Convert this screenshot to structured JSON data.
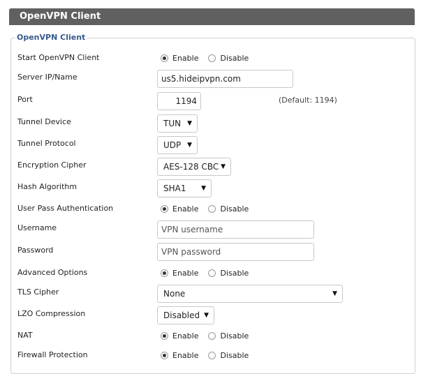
{
  "header": {
    "title": "OpenVPN Client"
  },
  "section": {
    "legend": "OpenVPN Client"
  },
  "labels": {
    "start": "Start OpenVPN Client",
    "server": "Server IP/Name",
    "port": "Port",
    "tunnel_device": "Tunnel Device",
    "tunnel_protocol": "Tunnel Protocol",
    "cipher": "Encryption Cipher",
    "hash": "Hash Algorithm",
    "userpass": "User Pass Authentication",
    "username": "Username",
    "password": "Password",
    "advanced": "Advanced Options",
    "tls": "TLS Cipher",
    "lzo": "LZO Compression",
    "nat": "NAT",
    "firewall": "Firewall Protection"
  },
  "radio": {
    "enable": "Enable",
    "disable": "Disable"
  },
  "fields": {
    "server_value": "us5.hideipvpn.com",
    "port_value": "1194",
    "port_hint": "(Default: 1194)",
    "username_placeholder": "VPN username",
    "password_placeholder": "VPN password"
  },
  "selects": {
    "tunnel_device": "TUN",
    "tunnel_protocol": "UDP",
    "cipher": "AES-128 CBC",
    "hash": "SHA1",
    "tls": "None",
    "lzo": "Disabled"
  },
  "icons": {
    "dropdown": "▼"
  }
}
